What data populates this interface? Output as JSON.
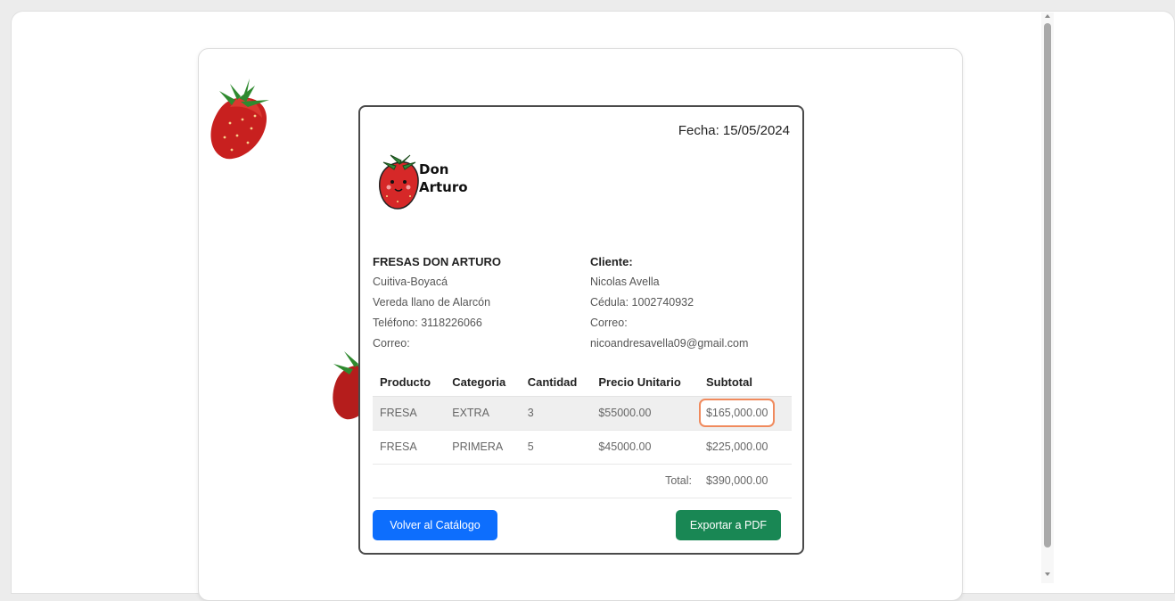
{
  "invoice": {
    "fecha": "Fecha: 15/05/2024",
    "logo_line1": "Don",
    "logo_line2": "Arturo",
    "seller": {
      "name": "FRESAS DON ARTURO",
      "city": "Cuitiva-Boyacá",
      "address": "Vereda llano de Alarcón",
      "phone": "Teléfono: 3118226066",
      "email": "Correo:"
    },
    "client": {
      "label": "Cliente:",
      "name": "Nicolas Avella",
      "id": "Cédula: 1002740932",
      "email_label": "Correo:",
      "email": "nicoandresavella09@gmail.com"
    },
    "table": {
      "headers": [
        "Producto",
        "Categoria",
        "Cantidad",
        "Precio Unitario",
        "Subtotal"
      ],
      "rows": [
        [
          "FRESA",
          "EXTRA",
          "3",
          "$55000.00",
          "$165,000.00"
        ],
        [
          "FRESA",
          "PRIMERA",
          "5",
          "$45000.00",
          "$225,000.00"
        ]
      ],
      "total_label": "Total:",
      "total_value": "$390,000.00"
    },
    "buttons": {
      "back": "Volver al Catálogo",
      "export": "Exportar a PDF"
    }
  },
  "colors": {
    "primary": "#0d6efd",
    "success": "#198754",
    "highlight": "#f08a5d",
    "strawberry": "#d62828"
  }
}
